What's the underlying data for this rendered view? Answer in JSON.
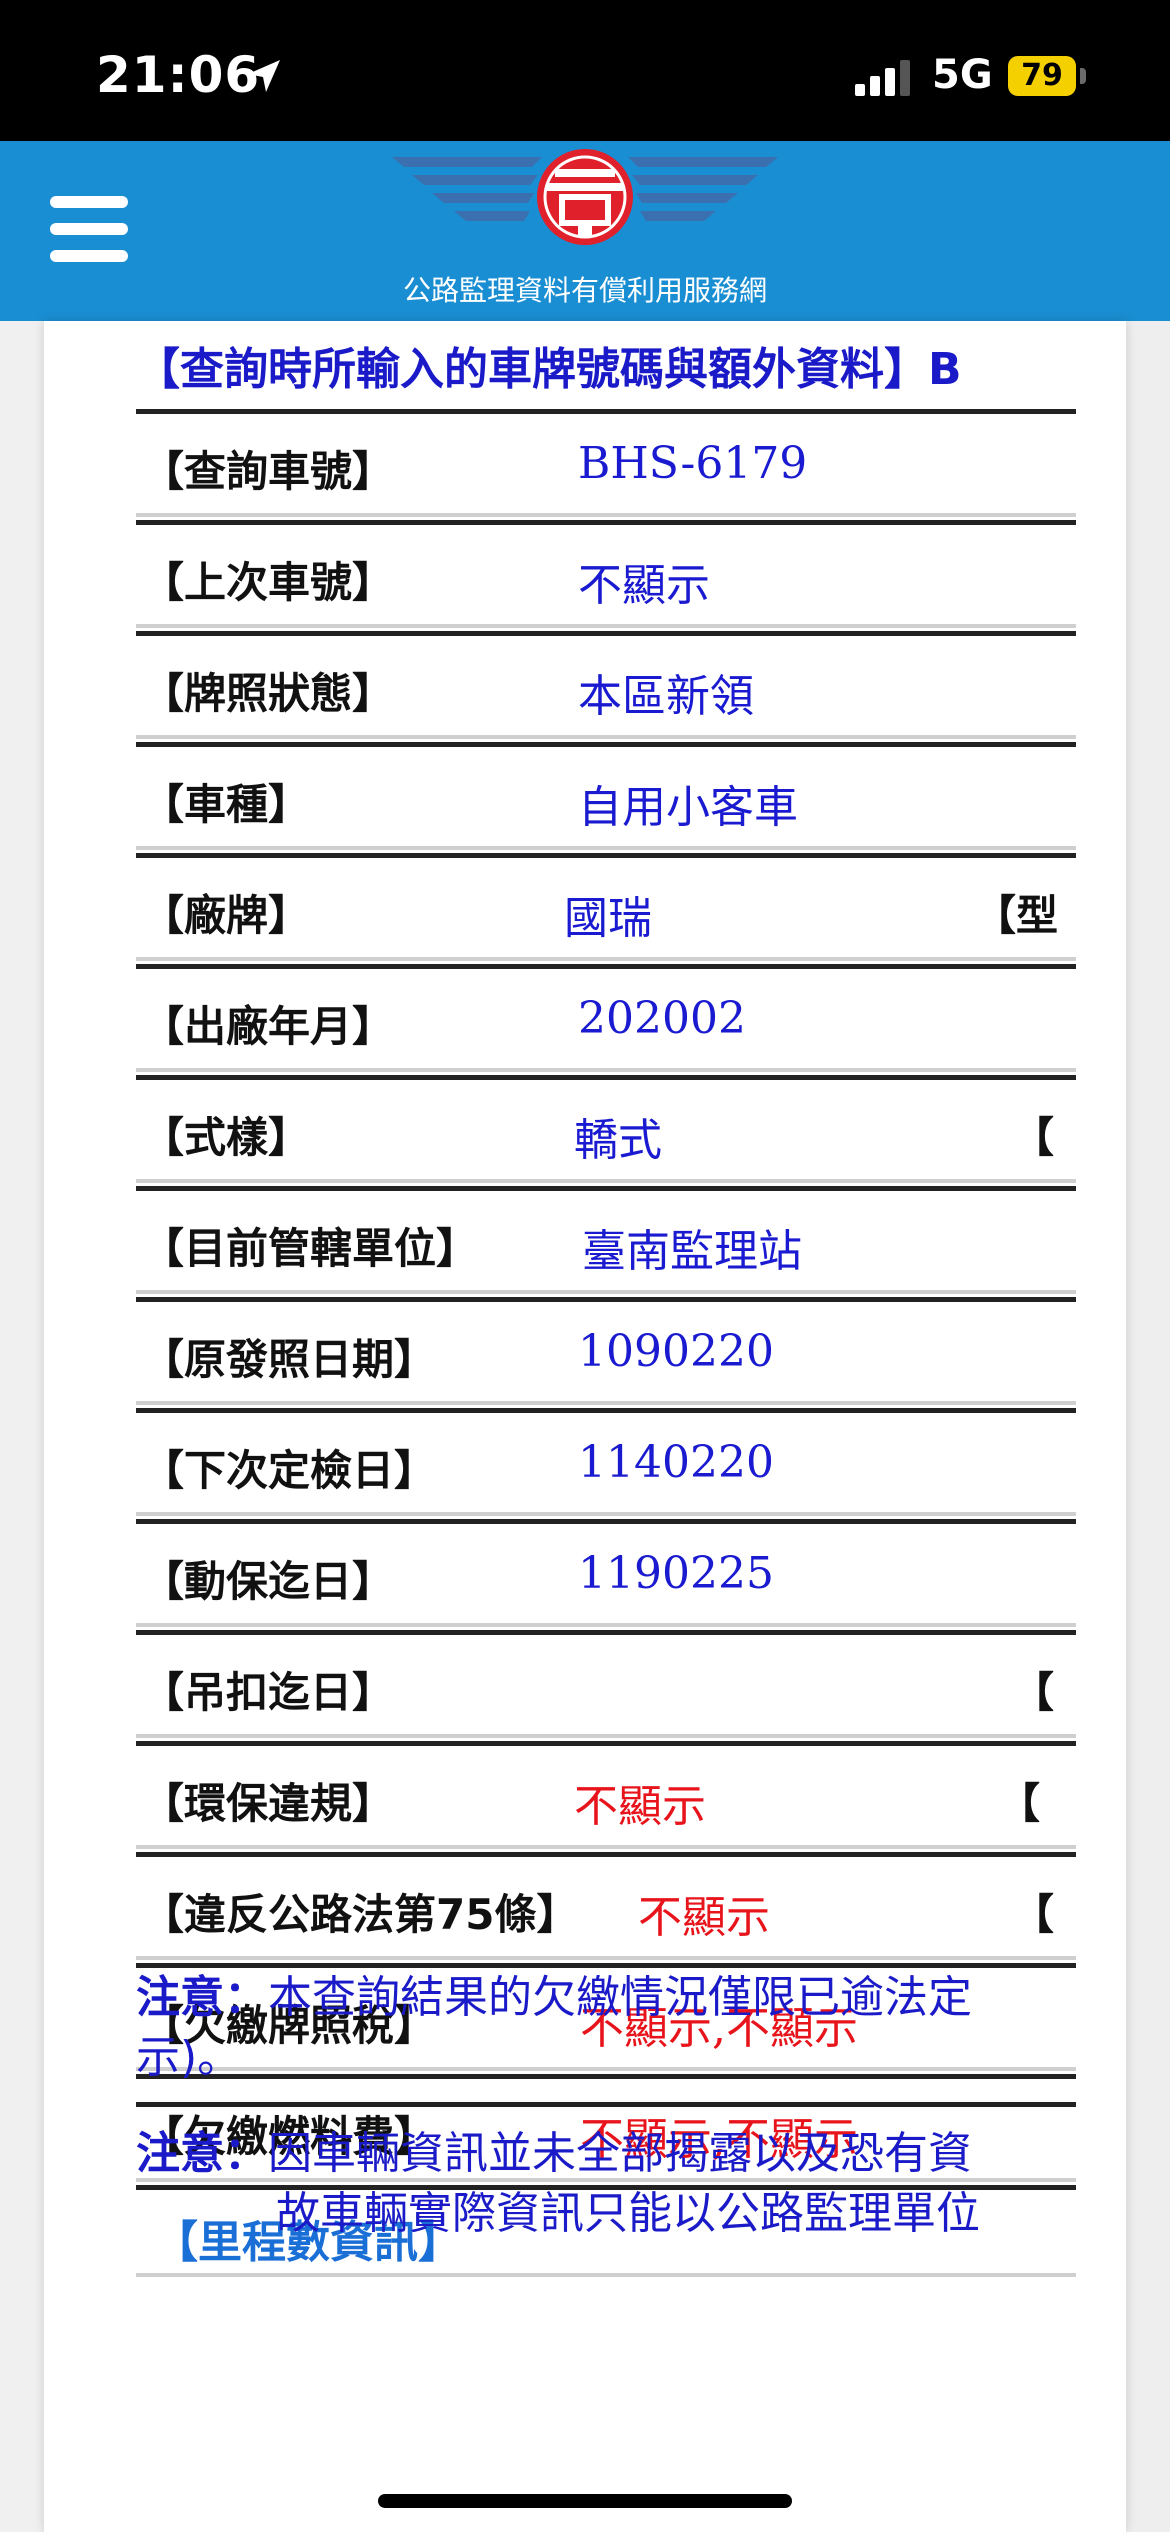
{
  "status_bar": {
    "time": "21:06",
    "network": "5G",
    "battery": "79"
  },
  "header": {
    "site_title": "公路監理資料有償利用服務網"
  },
  "caption": "【查詢時所輸入的車牌號碼與額外資料】B",
  "rows": [
    {
      "label": "【查詢車號】",
      "value": "BHS-6179",
      "value_color": "blue",
      "extra": ""
    },
    {
      "label": "【上次車號】",
      "value": "不顯示",
      "value_color": "blue",
      "extra": ""
    },
    {
      "label": "【牌照狀態】",
      "value": "本區新領",
      "value_color": "blue",
      "extra": ""
    },
    {
      "label": "【車種】",
      "value": "自用小客車",
      "value_color": "blue",
      "extra": ""
    },
    {
      "label": "【廠牌】",
      "value": "國瑞",
      "value_color": "blue",
      "extra": "【型"
    },
    {
      "label": "【出廠年月】",
      "value": "202002",
      "value_color": "blue",
      "extra": ""
    },
    {
      "label": "【式樣】",
      "value": "轎式",
      "value_color": "blue",
      "extra": "【"
    },
    {
      "label": "【目前管轄單位】",
      "value": "臺南監理站",
      "value_color": "blue",
      "extra": ""
    },
    {
      "label": "【原發照日期】",
      "value": "1090220",
      "value_color": "blue",
      "extra": ""
    },
    {
      "label": "【下次定檢日】",
      "value": "1140220",
      "value_color": "blue",
      "extra": ""
    },
    {
      "label": "【動保迄日】",
      "value": "1190225",
      "value_color": "blue",
      "extra": ""
    },
    {
      "label": "【吊扣迄日】",
      "value": "",
      "value_color": "blue",
      "extra": "【"
    },
    {
      "label": "【環保違規】",
      "value": "不顯示",
      "value_color": "red",
      "extra": "【"
    },
    {
      "label": "【違反公路法第75條】",
      "value": "不顯示",
      "value_color": "red",
      "extra": "【"
    },
    {
      "label": "【欠繳牌照稅】",
      "value": "不顯示,不顯示",
      "value_color": "red",
      "extra": ""
    },
    {
      "label": "【欠繳燃料費】",
      "value": "不顯示,不顯示",
      "value_color": "red",
      "extra": ""
    }
  ],
  "mileage": {
    "label": "【里程數資訊】"
  },
  "notes": [
    {
      "prefix": "注意：",
      "text": "本查詢結果的欠繳情況僅限已逾法定",
      "line2": "示)。"
    },
    {
      "prefix": "注意：",
      "text": "因車輛資訊並未全部揭露以及恐有資",
      "line2": "故車輛實際資訊只能以公路監理單位"
    }
  ],
  "colors": {
    "header_blue": "#1a8ed2",
    "value_blue": "#1a1ad0",
    "value_red": "#e8141c",
    "logo_red": "#e0202a"
  }
}
